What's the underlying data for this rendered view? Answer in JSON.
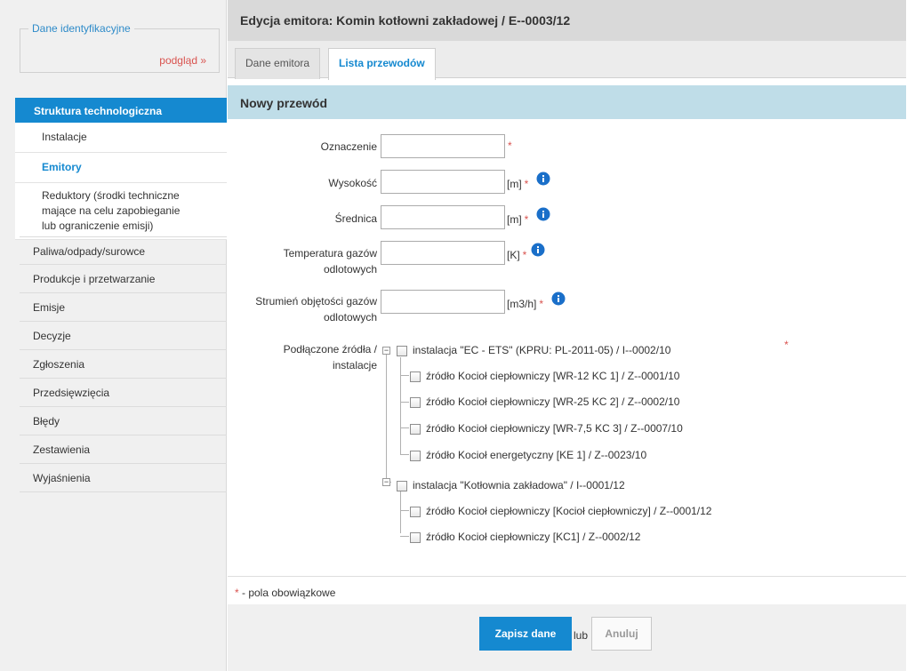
{
  "sidebar": {
    "id_box": {
      "legend": "Dane identyfikacyjne",
      "preview_link": "podgląd »"
    },
    "section_title": "Struktura technologiczna",
    "sub_items": [
      {
        "label": "Instalacje",
        "active": false
      },
      {
        "label": "Emitory",
        "active": true
      },
      {
        "label": "Reduktory (środki techniczne mające na celu zapobieganie lub ograniczenie emisji)",
        "active": false
      }
    ],
    "menu_items": [
      {
        "label": "Paliwa/odpady/surowce"
      },
      {
        "label": "Produkcje i przetwarzanie"
      },
      {
        "label": "Emisje"
      },
      {
        "label": "Decyzje"
      },
      {
        "label": "Zgłoszenia"
      },
      {
        "label": "Przedsięwzięcia"
      },
      {
        "label": "Błędy"
      },
      {
        "label": "Zestawienia"
      },
      {
        "label": "Wyjaśnienia"
      }
    ]
  },
  "header": {
    "title": "Edycja emitora: Komin kotłowni zakładowej / E--0003/12"
  },
  "tabs": [
    {
      "label": "Dane emitora",
      "active": false
    },
    {
      "label": "Lista przewodów",
      "active": true
    }
  ],
  "section": {
    "title": "Nowy przewód"
  },
  "form": {
    "required_mark": "*",
    "fields": [
      {
        "label": "Oznaczenie",
        "value": "",
        "unit": "",
        "required": true,
        "info": false
      },
      {
        "label": "Wysokość",
        "value": "",
        "unit": "[m]",
        "required": true,
        "info": true
      },
      {
        "label": "Średnica",
        "value": "",
        "unit": "[m]",
        "required": true,
        "info": true
      },
      {
        "label": "Temperatura gazów odlotowych",
        "value": "",
        "unit": "[K]",
        "required": true,
        "info": true
      },
      {
        "label": "Strumień objętości gazów odlotowych",
        "value": "",
        "unit": "[m3/h]",
        "required": true,
        "info": true
      }
    ],
    "tree_label": "Podłączone źródła / instalacje",
    "tree": [
      {
        "label": "instalacja \"EC - ETS\" (KPRU: PL-2011-05) / I--0002/10",
        "checked": false,
        "children": [
          {
            "label": "źródło Kocioł ciepłowniczy [WR-12 KC 1] / Z--0001/10",
            "checked": false
          },
          {
            "label": "źródło Kocioł ciepłowniczy [WR-25 KC 2] / Z--0002/10",
            "checked": false
          },
          {
            "label": "źródło Kocioł ciepłowniczy [WR-7,5 KC 3] / Z--0007/10",
            "checked": false
          },
          {
            "label": "źródło Kocioł energetyczny [KE 1] / Z--0023/10",
            "checked": false
          }
        ]
      },
      {
        "label": "instalacja \"Kotłownia zakładowa\" / I--0001/12",
        "checked": false,
        "children": [
          {
            "label": "źródło Kocioł ciepłowniczy [Kocioł ciepłowniczy] / Z--0001/12",
            "checked": false
          },
          {
            "label": "źródło Kocioł ciepłowniczy [KC1] / Z--0002/12",
            "checked": false
          }
        ]
      }
    ]
  },
  "footer": {
    "required_note_star": "*",
    "required_note": " - pola obowiązkowe",
    "save_label": "Zapisz dane",
    "or_label": "lub",
    "cancel_label": "Anuluj"
  },
  "colors": {
    "accent": "#1589d0",
    "section_bg": "#bfdde8",
    "required": "#d9534f"
  },
  "icons": {
    "info": "info-icon",
    "tree_toggle": "minus-toggle-icon"
  }
}
